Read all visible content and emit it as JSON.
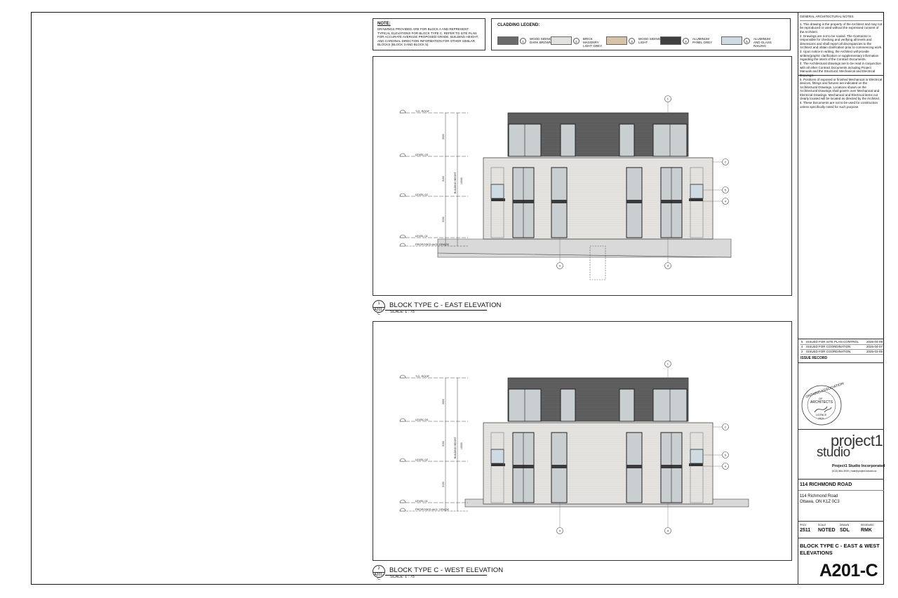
{
  "note": {
    "title": "NOTE:",
    "text": "DRAWINGS PROVIDED ARE FOR BLOCK A AND REPRESENT TYPICAL ELEVATIONS FOR BLOCK TYPE C. REFER TO SITE PLAN FOR ACCURATE AVERAGE PROPOSED GRADE, BUILDING HEIGHT, AND CARDINAL DIRECTION INFORMATION FOR OTHER SIMILAR BLOCKS (BLOCK 3 AND BLOCK 5)."
  },
  "cladding": {
    "title": "CLADDING LEGEND:",
    "items": [
      {
        "num": "1",
        "label": "WOOD SIDING DARK BROWN",
        "color": "#6a6a6a"
      },
      {
        "num": "2",
        "label": "BRICK MASONRY LIGHT GREY",
        "color": "#e4e2de"
      },
      {
        "num": "3",
        "label": "WOOD SIDING LIGHT",
        "color": "#d8c2a8"
      },
      {
        "num": "4",
        "label": "ALUMINUM PANEL GREY",
        "color": "#3f3f3f"
      },
      {
        "num": "5",
        "label": "ALUMINUM AND GLASS RAILING",
        "color": "#cfdbe2"
      }
    ]
  },
  "general_notes": {
    "title": "GENERAL ARCHITECTURAL NOTES",
    "items": [
      "1.  This drawing is the property of the Architect and may not be reproduced or used without the expressed consent of the Architect.",
      "2.  Drawings are not to be scaled. The Contractor is responsible for checking and verifying all levels and dimensions and shall report all discrepancies to the Architect and obtain clarification prior to commencing work.",
      "3.  Upon notice in writing, the Architect will provide written/graphic clarification or supplementary information regarding the intent of the Contract Documents.",
      "4.  The Architectural drawings are to be read in conjunction with all other Contract Documents including Project Manuals and the Structural, Mechanical and Electrical Drawings.",
      "5.  Positions of exposed or finished Mechanical or Electrical devices, fittings and fixtures are indicated on the Architectural Drawings. Locations shown on the Architectural Drawings shall govern over Mechanical and Electrical Drawings. Mechanical and Electrical items not clearly located will be located as directed by the Architect.",
      "6.  These Documents are not to be used for construction unless specifically noted for such purpose."
    ]
  },
  "views": [
    {
      "num": "1",
      "sheet": "A201-C",
      "title": "BLOCK TYPE C - EAST ELEVATION",
      "scale": "SCALE: 1 : 75",
      "levels": [
        "T.O. ROOF",
        "LEVEL 03",
        "LEVEL 02",
        "LEVEL 01",
        "PROPOSED AVG. GRADE"
      ],
      "dims": [
        "3000",
        "3150",
        "3150",
        "BUILDING HEIGHT",
        "10000"
      ]
    },
    {
      "num": "2",
      "sheet": "A201-C",
      "title": "BLOCK TYPE C - WEST ELEVATION",
      "scale": "SCALE: 1 : 75",
      "levels": [
        "T.O. ROOF",
        "LEVEL 03",
        "LEVEL 02",
        "LEVEL 01",
        "PROPOSED AVG. GRADE"
      ],
      "dims": [
        "3000",
        "3150",
        "3150",
        "BUILDING HEIGHT",
        "10000"
      ]
    }
  ],
  "issues": {
    "title": "ISSUE RECORD",
    "rows": [
      {
        "num": "5",
        "desc": "ISSUED FOR SITE PLAN CONTROL",
        "date": "2026-04-09"
      },
      {
        "num": "4",
        "desc": "ISSUED FOR COORDINATION",
        "date": "2026-04-07"
      },
      {
        "num": "2",
        "desc": "ISSUED FOR COORDINATION",
        "date": "2026-03-05"
      }
    ]
  },
  "stamp": {
    "org_top": "ONTARIO ASSOCIATION",
    "of": "OF",
    "org_bottom": "ARCHITECTS",
    "licence": "LICENCE",
    "number": "7010"
  },
  "firm": {
    "logo_line1": "project1",
    "logo_line2": "studio",
    "name": "Project1 Studio Incorporated",
    "contact": "(613) 884-3939  |  mail@project1studio.ca"
  },
  "project": {
    "title": "114 RICHMOND ROAD",
    "address1": "114 Richmond Road",
    "address2": "Ottawa, ON K1Z 0C3"
  },
  "meta": {
    "proj_label": "PROJ",
    "proj": "2511",
    "scale_label": "SCALE",
    "scale": "NOTED",
    "drawn_label": "DRAWN",
    "drawn": "SDL",
    "reviewed_label": "REVIEWED",
    "reviewed": "RMK"
  },
  "sheet": {
    "title": "BLOCK TYPE C - EAST & WEST ELEVATIONS",
    "number": "A201-C"
  }
}
